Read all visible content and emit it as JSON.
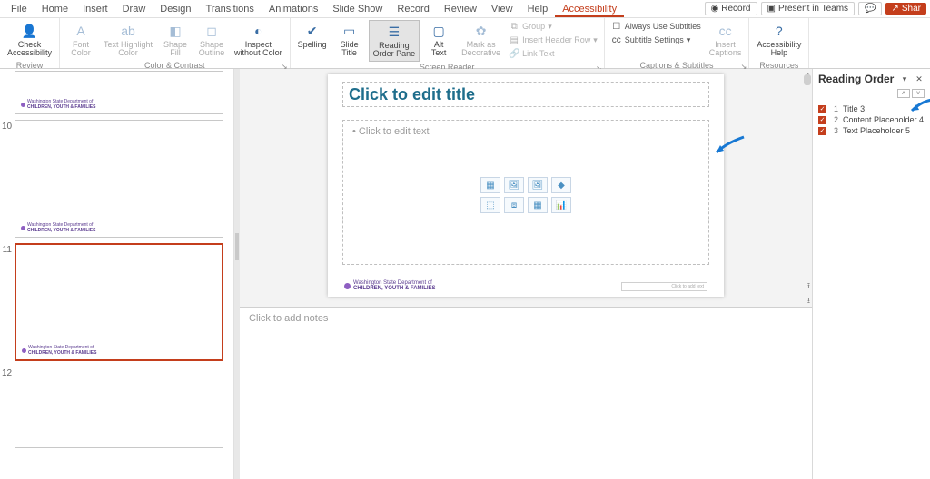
{
  "tabs": {
    "items": [
      "File",
      "Home",
      "Insert",
      "Draw",
      "Design",
      "Transitions",
      "Animations",
      "Slide Show",
      "Record",
      "Review",
      "View",
      "Help",
      "Accessibility"
    ],
    "active_index": 12,
    "right": {
      "record": "Record",
      "present": "Present in Teams",
      "share": "Shar"
    }
  },
  "ribbon": {
    "review": {
      "label": "Review",
      "check": "Check\nAccessibility"
    },
    "color": {
      "label": "Color & Contrast",
      "font_color": "Font\nColor",
      "highlight": "Text Highlight\nColor",
      "shape_fill": "Shape\nFill",
      "shape_outline": "Shape\nOutline",
      "inspect": "Inspect\nwithout Color"
    },
    "spelling": "Spelling",
    "slide_title": "Slide\nTitle",
    "reading": "Reading\nOrder Pane",
    "screen_reader": {
      "label": "Screen Reader",
      "alt": "Alt\nText",
      "mark": "Mark as\nDecorative",
      "header": "Insert Header Row",
      "link": "Link Text",
      "group": "Group"
    },
    "captions": {
      "label": "Captions & Subtitles",
      "always": "Always Use Subtitles",
      "settings": "Subtitle Settings",
      "insert": "Insert\nCaptions"
    },
    "resources": {
      "label": "Resources",
      "help": "Accessibility\nHelp"
    }
  },
  "thumbs": {
    "footer_line1": "Washington State Department of",
    "footer_line2": "CHILDREN, YOUTH & FAMILIES",
    "nums": [
      "",
      "10",
      "11",
      "12"
    ],
    "selected_index": 2
  },
  "slide": {
    "title_placeholder": "Click to edit title",
    "body_placeholder": "Click to edit text",
    "footer_line1": "Washington State Department of",
    "footer_line2": "CHILDREN, YOUTH & FAMILIES",
    "click_text": "Click to add text"
  },
  "notes": {
    "placeholder": "Click to add notes"
  },
  "reading_pane": {
    "title": "Reading Order",
    "items": [
      {
        "n": "1",
        "label": "Title 3"
      },
      {
        "n": "2",
        "label": "Content Placeholder 4"
      },
      {
        "n": "3",
        "label": "Text Placeholder 5"
      }
    ]
  }
}
